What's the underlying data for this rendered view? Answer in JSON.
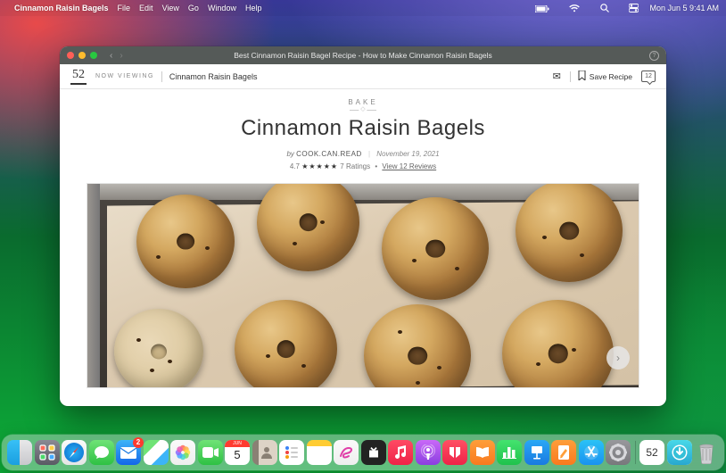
{
  "menubar": {
    "app": "Cinnamon Raisin Bagels",
    "items": [
      "File",
      "Edit",
      "View",
      "Go",
      "Window",
      "Help"
    ],
    "clock": "Mon Jun 5 9:41 AM"
  },
  "window": {
    "title": "Best Cinnamon Raisin Bagel Recipe - How to Make Cinnamon Raisin Bagels"
  },
  "pagebar": {
    "logo": "52",
    "now_viewing": "NOW VIEWING",
    "crumb": "Cinnamon Raisin Bagels",
    "save": "Save Recipe",
    "comments": "12"
  },
  "article": {
    "category": "BAKE",
    "title": "Cinnamon Raisin Bagels",
    "by": "by",
    "author": "COOK.CAN.READ",
    "date": "November 19, 2021",
    "rating_value": "4.7",
    "stars": "★★★★★",
    "ratings_count": "7 Ratings",
    "bullet": "•",
    "reviews": "View 12 Reviews"
  },
  "calendar": {
    "month": "JUN",
    "day": "5"
  },
  "mail_badge": "2",
  "logo52_dock": "52"
}
